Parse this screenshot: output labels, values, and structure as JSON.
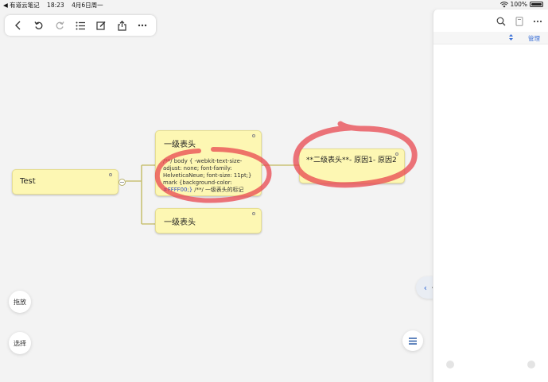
{
  "status_bar": {
    "back_app": "◀ 有道云笔记",
    "time": "18:23",
    "date": "4月6日周一",
    "battery": "100%"
  },
  "toolbar": {
    "icons": [
      "chevron-left-icon",
      "undo-icon",
      "redo-icon",
      "outline-list-icon",
      "edit-icon",
      "share-icon",
      "more-icon"
    ]
  },
  "mindmap": {
    "root": {
      "text": "Test"
    },
    "children": [
      {
        "text": "一级表头",
        "note_line1": "/**/ body { -webkit-text-size-",
        "note_line2": "adjust: none; font-family:",
        "note_line3": "HelveticaNeue; font-size: 11pt;}",
        "note_line4": "mark {background-color:",
        "note_hex": "#FFFF00;}",
        "note_tail": " /**/   一级表头的标记"
      },
      {
        "text": "一级表头"
      }
    ],
    "grandchild": {
      "text": "**二级表头**- 原因1- 原因2"
    }
  },
  "colors": {
    "node_fill": "#fdf7b3",
    "annotation": "#e8474f",
    "accent": "#3a6fd6",
    "connector": "#c9c276"
  },
  "buttons": {
    "drag": "拖放",
    "select": "选择"
  },
  "panel": {
    "manage": "管理"
  }
}
